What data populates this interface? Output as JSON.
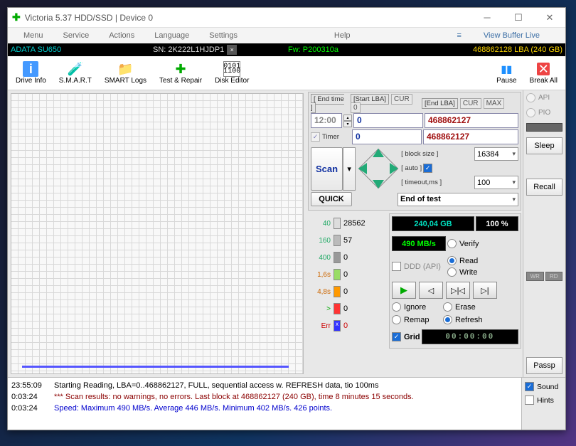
{
  "window": {
    "title": "Victoria 5.37 HDD/SSD | Device 0"
  },
  "menu": {
    "items": [
      "Menu",
      "Service",
      "Actions",
      "Language",
      "Settings"
    ],
    "help": "Help",
    "view_buffer": "View Buffer Live"
  },
  "infobar": {
    "device": "ADATA SU650",
    "sn": "SN: 2K222L1HJDP1",
    "fw": "Fw: P200310a",
    "lba": "468862128 LBA (240 GB)"
  },
  "toolbar": {
    "drive_info": "Drive Info",
    "smart": "S.M.A.R.T",
    "smart_logs": "SMART Logs",
    "test_repair": "Test & Repair",
    "disk_editor": "Disk Editor",
    "pause": "Pause",
    "break_all": "Break All"
  },
  "controls": {
    "end_time_lbl": "[ End time ]",
    "end_time_val": "12:00",
    "timer": "Timer",
    "start_lba_lbl": "[Start LBA]",
    "cur": "CUR",
    "zero": "0",
    "start_lba": "0",
    "start_lba2": "0",
    "end_lba_lbl": "[End LBA]",
    "max": "MAX",
    "end_lba": "468862127",
    "end_lba2": "468862127",
    "scan": "Scan",
    "quick": "QUICK",
    "block_size_lbl": "[ block size ]",
    "block_size": "16384",
    "auto": "[ auto ]",
    "timeout_lbl": "[ timeout,ms ]",
    "timeout": "100",
    "end_test": "End of test"
  },
  "stats": {
    "size": "240,04 GB",
    "pct": "100   %",
    "speed": "490 MB/s"
  },
  "modes": {
    "verify": "Verify",
    "ddd": "DDD (API)",
    "read": "Read",
    "write": "Write"
  },
  "blocks": {
    "t40": "40",
    "v40": "28562",
    "t160": "160",
    "v160": "57",
    "t400": "400",
    "v400": "0",
    "t16": "1,6s",
    "v16": "0",
    "t48": "4,8s",
    "v48": "0",
    "tg": ">",
    "vg": "0",
    "terr": "Err",
    "verr": "0"
  },
  "actions": {
    "ignore": "Ignore",
    "erase": "Erase",
    "remap": "Remap",
    "refresh": "Refresh"
  },
  "grid": "Grid",
  "timer_val": "00:00:00",
  "right": {
    "api": "API",
    "pio": "PIO",
    "sleep": "Sleep",
    "recall": "Recall",
    "wr": "WR",
    "rd": "RD",
    "passp": "Passp"
  },
  "log": [
    {
      "ts": "23:55:09",
      "msg": "Starting Reading, LBA=0..468862127, FULL, sequential access w. REFRESH data, tio 100ms",
      "cls": ""
    },
    {
      "ts": "0:03:24",
      "msg": "*** Scan results: no warnings, no errors. Last block at 468862127 (240 GB), time 8 minutes 15 seconds.",
      "cls": "red"
    },
    {
      "ts": "0:03:24",
      "msg": "Speed: Maximum 490 MB/s. Average 446 MB/s. Minimum 402 MB/s. 426 points.",
      "cls": "blue"
    }
  ],
  "logopts": {
    "sound": "Sound",
    "hints": "Hints"
  }
}
